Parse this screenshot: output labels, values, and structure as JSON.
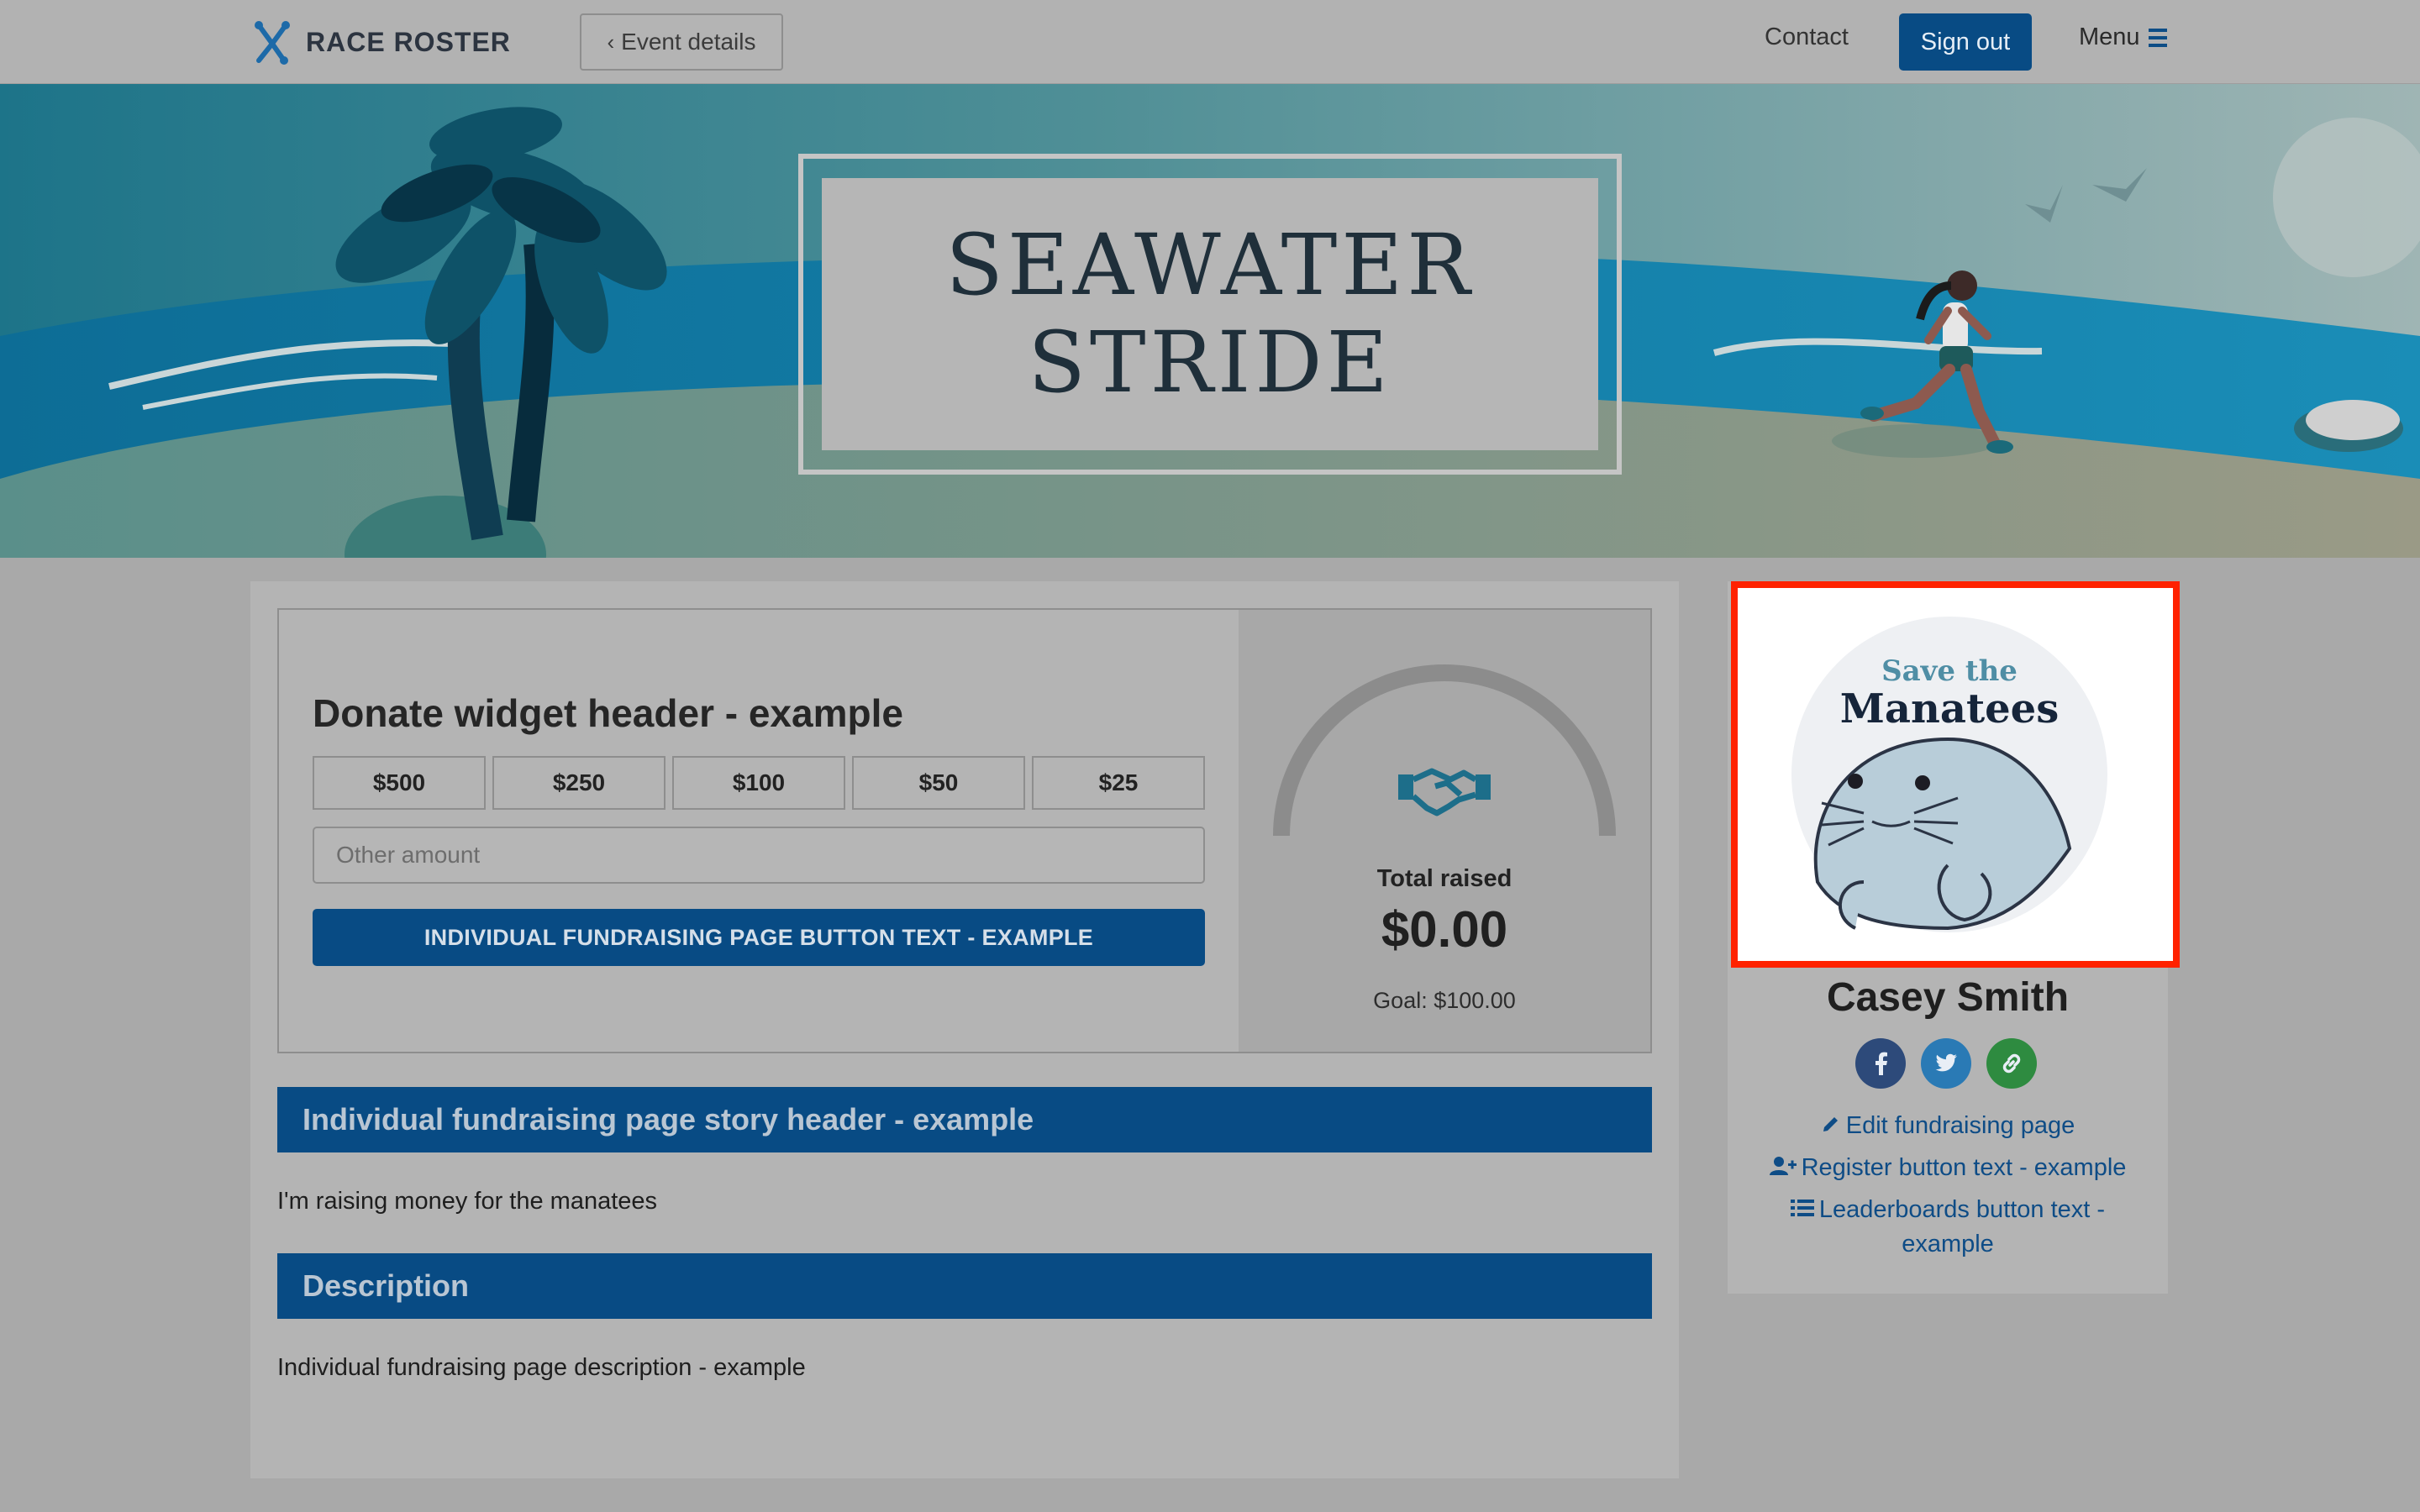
{
  "header": {
    "logo_text": "RACE ROSTER",
    "event_details_label": "Event details",
    "contact_label": "Contact",
    "signout_label": "Sign out",
    "menu_label": "Menu"
  },
  "banner": {
    "title_line1": "SEAWATER",
    "title_line2": "STRIDE"
  },
  "donate": {
    "header": "Donate widget header - example",
    "amounts": [
      "$500",
      "$250",
      "$100",
      "$50",
      "$25"
    ],
    "other_placeholder": "Other amount",
    "button_label": "INDIVIDUAL FUNDRAISING PAGE BUTTON TEXT - EXAMPLE",
    "total_label": "Total raised",
    "total_value": "$0.00",
    "goal_text": "Goal: $100.00",
    "progress_fraction": 0.0
  },
  "story": {
    "header": "Individual fundraising page story header - example",
    "text": "I'm raising money for the manatees"
  },
  "description": {
    "header": "Description",
    "text": "Individual fundraising page description - example"
  },
  "sidebar": {
    "image_text_line1": "Save the",
    "image_text_line2": "Manatees",
    "name": "Casey Smith",
    "social": [
      "facebook-icon",
      "twitter-icon",
      "link-icon"
    ],
    "edit_link": "Edit fundraising page",
    "register_link": "Register button text - example",
    "leaderboards_link_line1": "Leaderboards button text -",
    "leaderboards_link_line2": "example"
  },
  "colors": {
    "primary_blue": "#084b84",
    "highlight_red": "#ff2200",
    "facebook": "#2d4a7a",
    "twitter": "#2a7ab5",
    "link_green": "#2e8b40"
  }
}
